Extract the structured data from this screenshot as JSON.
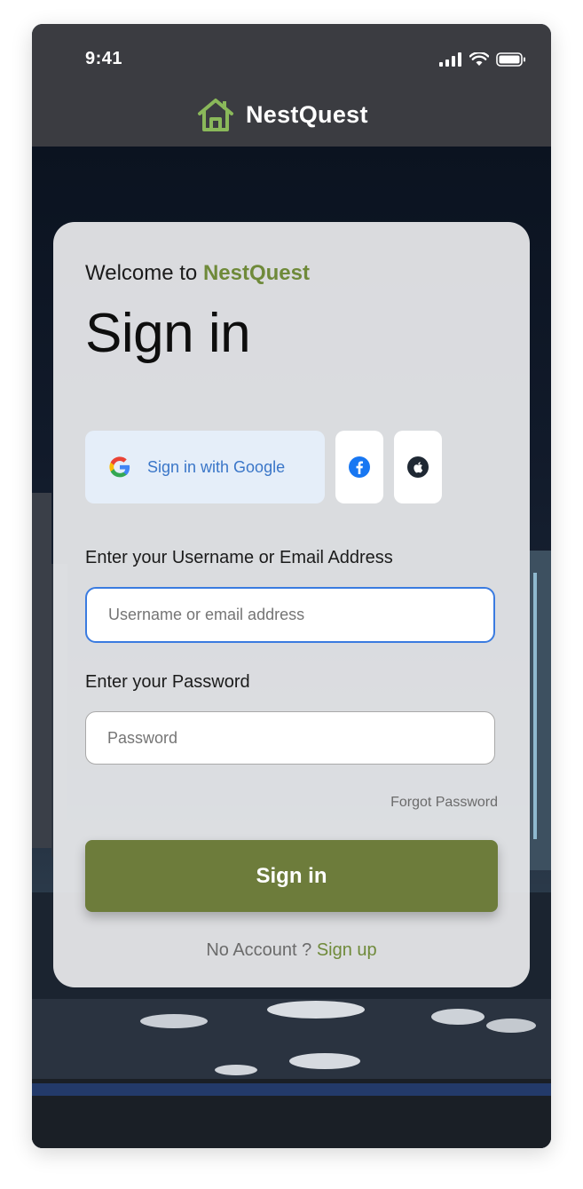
{
  "status_bar": {
    "time": "9:41"
  },
  "header": {
    "app_name": "NestQuest",
    "logo_icon": "house-icon",
    "brand_color": "#8ab85a"
  },
  "card": {
    "welcome_prefix": "Welcome to",
    "welcome_brand": "NestQuest",
    "title": "Sign in"
  },
  "social": {
    "google_label": "Sign in with Google",
    "facebook_icon": "facebook-icon",
    "apple_icon": "apple-icon"
  },
  "form": {
    "username_label": "Enter your Username or Email Address",
    "username_placeholder": "Username or email address",
    "username_value": "",
    "password_label": "Enter your Password",
    "password_placeholder": "Password",
    "password_value": "",
    "forgot_label": "Forgot Password",
    "submit_label": "Sign in",
    "no_account_text": "No Account ?",
    "signup_label": "Sign up"
  },
  "colors": {
    "accent": "#6f8a3a",
    "button": "#6d7c3b",
    "google_bg": "#e5eef9",
    "focus": "#3a7be0",
    "header_bg": "#3b3c41"
  }
}
